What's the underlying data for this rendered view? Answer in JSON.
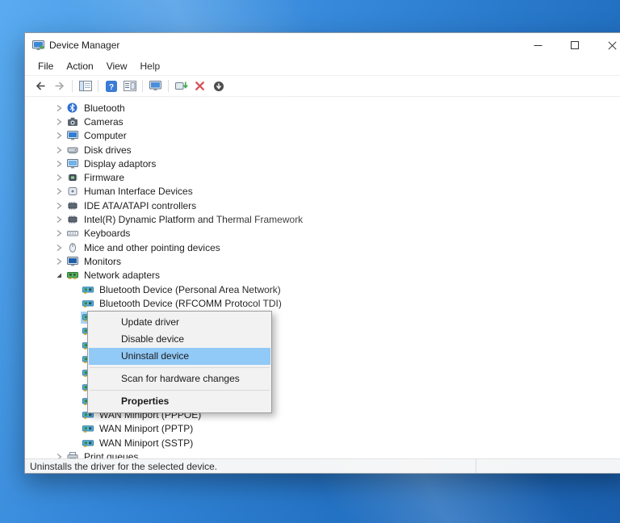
{
  "window": {
    "title": "Device Manager",
    "menu": [
      "File",
      "Action",
      "View",
      "Help"
    ],
    "toolbar_groups": [
      [
        "back",
        "forward"
      ],
      [
        "console-tree"
      ],
      [
        "help",
        "properties"
      ],
      [
        "devices"
      ],
      [
        "update-driver",
        "uninstall",
        "disable-device"
      ]
    ],
    "caption_buttons": [
      "minimize",
      "maximize",
      "close"
    ],
    "status": "Uninstalls the driver for the selected device."
  },
  "tree": [
    {
      "label": "Bluetooth",
      "icon": "bluetooth",
      "level": 0,
      "expander": "collapsed"
    },
    {
      "label": "Cameras",
      "icon": "camera",
      "level": 0,
      "expander": "collapsed"
    },
    {
      "label": "Computer",
      "icon": "computer",
      "level": 0,
      "expander": "collapsed"
    },
    {
      "label": "Disk drives",
      "icon": "disk",
      "level": 0,
      "expander": "collapsed"
    },
    {
      "label": "Display adaptors",
      "icon": "display",
      "level": 0,
      "expander": "collapsed"
    },
    {
      "label": "Firmware",
      "icon": "firmware",
      "level": 0,
      "expander": "collapsed"
    },
    {
      "label": "Human Interface Devices",
      "icon": "hid",
      "level": 0,
      "expander": "collapsed"
    },
    {
      "label": "IDE ATA/ATAPI controllers",
      "icon": "chip",
      "level": 0,
      "expander": "collapsed"
    },
    {
      "label": "Intel(R) Dynamic Platform and Thermal Framework",
      "icon": "chip",
      "level": 0,
      "expander": "collapsed"
    },
    {
      "label": "Keyboards",
      "icon": "keyboard",
      "level": 0,
      "expander": "collapsed"
    },
    {
      "label": "Mice and other pointing devices",
      "icon": "mouse",
      "level": 0,
      "expander": "collapsed"
    },
    {
      "label": "Monitors",
      "icon": "monitor",
      "level": 0,
      "expander": "collapsed"
    },
    {
      "label": "Network adapters",
      "icon": "network",
      "level": 0,
      "expander": "expanded"
    },
    {
      "label": "Bluetooth Device (Personal Area Network)",
      "icon": "netadapter",
      "level": 1
    },
    {
      "label": "Bluetooth Device (RFCOMM Protocol TDI)",
      "icon": "netadapter",
      "level": 1
    },
    {
      "label": "",
      "icon": "netadapter",
      "level": 1,
      "selected": true
    },
    {
      "label": "",
      "icon": "netadapter",
      "level": 1
    },
    {
      "label": "",
      "icon": "netadapter",
      "level": 1
    },
    {
      "label": "",
      "icon": "netadapter",
      "level": 1
    },
    {
      "label": "",
      "icon": "netadapter",
      "level": 1
    },
    {
      "label": "",
      "icon": "netadapter",
      "level": 1
    },
    {
      "label": "",
      "icon": "netadapter",
      "level": 1
    },
    {
      "label": "WAN Miniport (PPPOE)",
      "icon": "netadapter",
      "level": 1
    },
    {
      "label": "WAN Miniport (PPTP)",
      "icon": "netadapter",
      "level": 1
    },
    {
      "label": "WAN Miniport (SSTP)",
      "icon": "netadapter",
      "level": 1
    },
    {
      "label": "Print queues",
      "icon": "printer",
      "level": 0,
      "expander": "collapsed"
    }
  ],
  "context_menu": {
    "items": [
      {
        "label": "Update driver"
      },
      {
        "label": "Disable device"
      },
      {
        "label": "Uninstall device",
        "highlighted": true
      },
      {
        "separator": true
      },
      {
        "label": "Scan for hardware changes"
      },
      {
        "separator": true
      },
      {
        "label": "Properties",
        "bold": true
      }
    ]
  },
  "colors": {
    "tree_selection": "#a9d3f1",
    "menu_highlight": "#91c9f7",
    "desktop_top": "#5aabf0",
    "desktop_bottom": "#1a5fae",
    "uninstall_red": "#d13438",
    "help_blue": "#3a7bd5"
  }
}
